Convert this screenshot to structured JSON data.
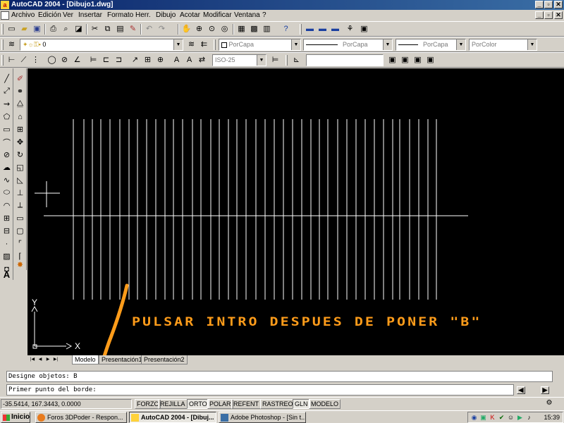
{
  "window": {
    "title": "AutoCAD 2004 - [Dibujo1.dwg]",
    "app_icon": "autocad-icon",
    "controls": [
      "_",
      "▫",
      "✕"
    ]
  },
  "menubar": {
    "items": [
      "Archivo",
      "Edición",
      "Ver",
      "Insertar",
      "Formato",
      "Herr.",
      "Dibujo",
      "Acotar",
      "Modificar",
      "Ventana",
      "?"
    ]
  },
  "properties": {
    "layer_value": "0",
    "color": "PorCapa",
    "linetype": "PorCapa",
    "lineweight": "PorCapa",
    "plotstyle": "PorColor"
  },
  "dimstyle": {
    "value": "ISO-25"
  },
  "annotation": {
    "text": "PULSAR INTRO DESPUES DE PONER \"B\"",
    "color": "#ff9c1a"
  },
  "ucs": {
    "x_label": "X",
    "y_label": "Y"
  },
  "layout_tabs": [
    "Modelo",
    "Presentación1",
    "Presentación2"
  ],
  "command": {
    "history_line": "Designe objetos: B",
    "prompt_line": "Primer punto del borde:"
  },
  "status": {
    "coordinates": "-35.5414, 167.3443, 0.0000",
    "buttons": [
      {
        "label": "FORZC",
        "on": false
      },
      {
        "label": "REJILLA",
        "on": false
      },
      {
        "label": "ORTO",
        "on": true
      },
      {
        "label": "POLAR",
        "on": false
      },
      {
        "label": "REFENT",
        "on": false
      },
      {
        "label": "RASTREO",
        "on": false
      },
      {
        "label": "GLN",
        "on": true
      },
      {
        "label": "MODELO",
        "on": false
      }
    ]
  },
  "taskbar": {
    "start_label": "Inicio",
    "tasks": [
      {
        "label": "Foros 3DPoder - Respon...",
        "active": false
      },
      {
        "label": "AutoCAD 2004 - [Dibuj...",
        "active": true
      },
      {
        "label": "Adobe Photoshop - [Sin t...",
        "active": false
      }
    ],
    "clock": "15:39"
  },
  "colors": {
    "drawing_background": "#000000",
    "geometry": "#ffffff",
    "titlebar": "#0a246a"
  }
}
